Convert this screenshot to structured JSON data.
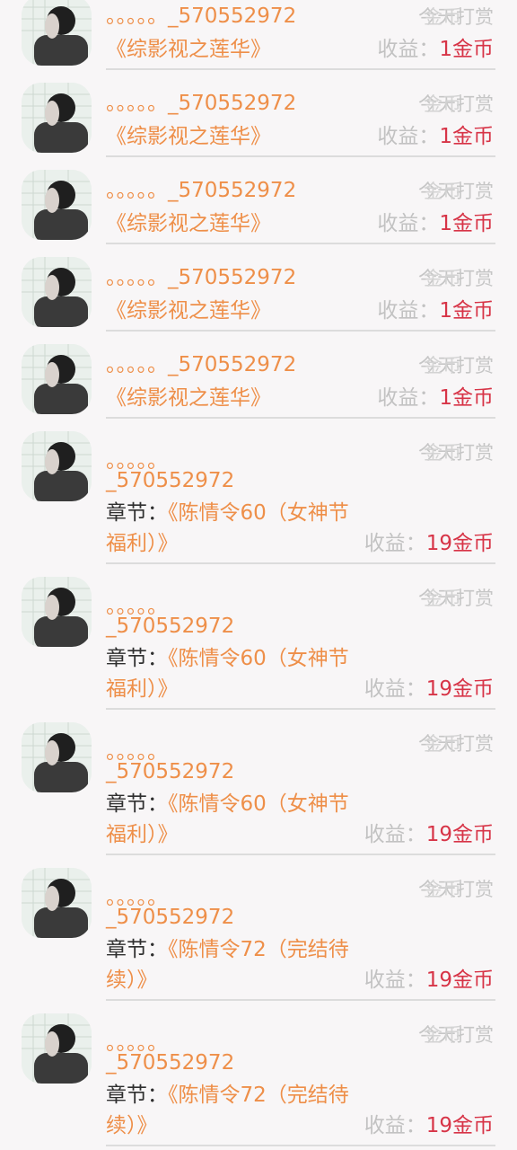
{
  "rows": [
    {
      "name": "。。。。。_570552972",
      "book": "《综影视之莲华》",
      "time": "今天",
      "coin_top": "金币",
      "reward": "打赏",
      "income_label": "收益：",
      "amount": "1金币"
    },
    {
      "name": "。。。。。_570552972",
      "book": "《综影视之莲华》",
      "time": "今天",
      "coin_top": "金币",
      "reward": "打赏",
      "income_label": "收益：",
      "amount": "1金币"
    },
    {
      "name": "。。。。。_570552972",
      "book": "《综影视之莲华》",
      "time": "今天",
      "coin_top": "金币",
      "reward": "打赏",
      "income_label": "收益：",
      "amount": "1金币"
    },
    {
      "name": "。。。。。_570552972",
      "book": "《综影视之莲华》",
      "time": "今天",
      "coin_top": "金币",
      "reward": "打赏",
      "income_label": "收益：",
      "amount": "1金币"
    },
    {
      "name": "。。。。。_570552972",
      "book": "《综影视之莲华》",
      "time": "今天",
      "coin_top": "金币",
      "reward": "打赏",
      "income_label": "收益：",
      "amount": "1金币"
    }
  ],
  "chapter_rows": [
    {
      "name_dots": "。。。。。",
      "name_id": "_570552972",
      "chapter_label": "章节：",
      "chapter_title": "《陈情令60（女神节福利）》",
      "time": "今天",
      "coin_top": "金币",
      "reward": "打赏",
      "income_label": "收益：",
      "amount": "19金币"
    },
    {
      "name_dots": "。。。。。",
      "name_id": "_570552972",
      "chapter_label": "章节：",
      "chapter_title": "《陈情令60（女神节福利）》",
      "time": "今天",
      "coin_top": "金币",
      "reward": "打赏",
      "income_label": "收益：",
      "amount": "19金币"
    },
    {
      "name_dots": "。。。。。",
      "name_id": "_570552972",
      "chapter_label": "章节：",
      "chapter_title": "《陈情令60（女神节福利）》",
      "time": "今天",
      "coin_top": "金币",
      "reward": "打赏",
      "income_label": "收益：",
      "amount": "19金币"
    },
    {
      "name_dots": "。。。。。",
      "name_id": "_570552972",
      "chapter_label": "章节：",
      "chapter_title": "《陈情令72（完结待续）》",
      "time": "今天",
      "coin_top": "金币",
      "reward": "打赏",
      "income_label": "收益：",
      "amount": "19金币"
    },
    {
      "name_dots": "。。。。。",
      "name_id": "_570552972",
      "chapter_label": "章节：",
      "chapter_title": "《陈情令72（完结待续）》",
      "time": "今天",
      "coin_top": "金币",
      "reward": "打赏",
      "income_label": "收益：",
      "amount": "19金币"
    }
  ],
  "colors": {
    "name": "#ee8f49",
    "amount": "#d73447",
    "muted": "#c2c2c2",
    "divider": "#dcdcdc"
  }
}
